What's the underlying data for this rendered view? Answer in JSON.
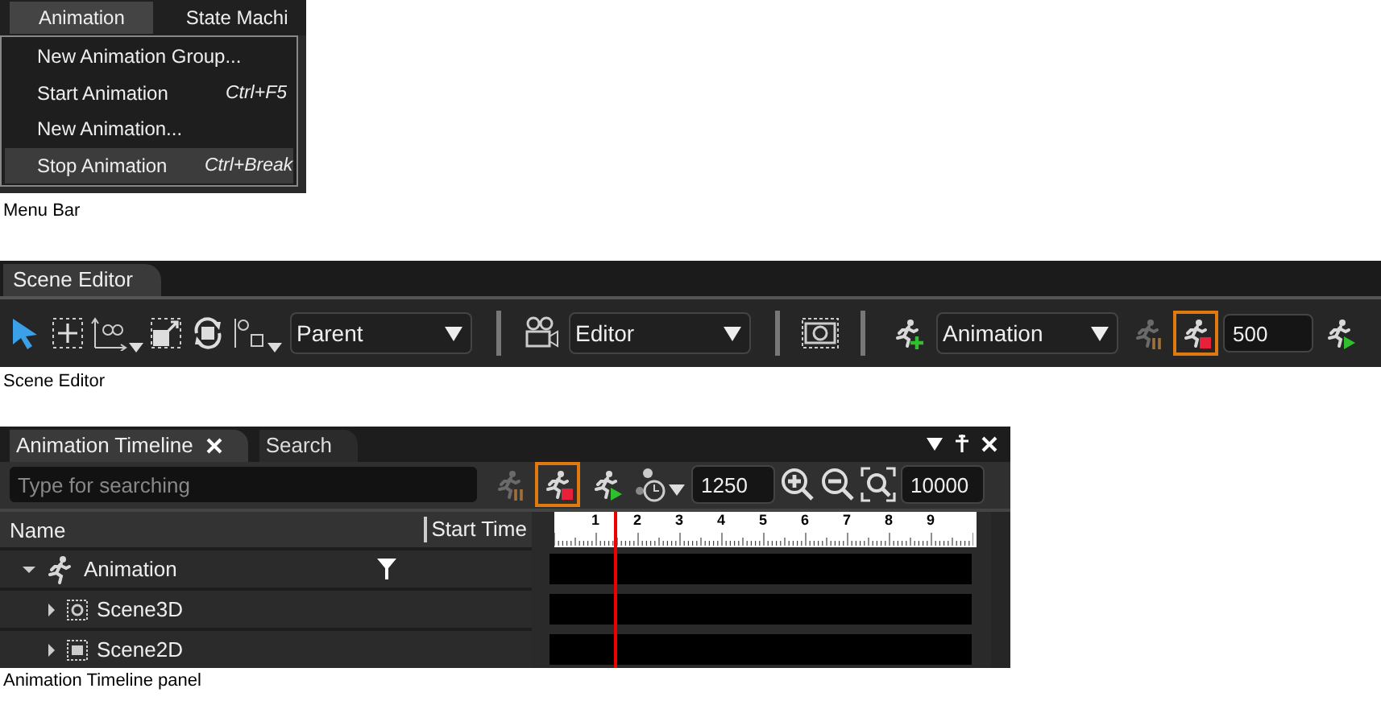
{
  "menu_screenshot": {
    "menus": [
      {
        "label": "Animation",
        "selected": true
      },
      {
        "label": "State Machi",
        "selected": false
      }
    ],
    "menu_items": [
      {
        "label": "New Animation Group...",
        "selected": false
      },
      {
        "label": "Start Animation",
        "shortcut": "Ctrl+F5",
        "selected": false
      },
      {
        "label": "New Animation...",
        "selected": false
      },
      {
        "label": "Stop Animation",
        "shortcut": "Ctrl+Break",
        "selected": true
      }
    ],
    "caption": "Menu Bar"
  },
  "scene_editor_screenshot": {
    "tab": "Scene Editor",
    "coordinate_dropdown": "Parent",
    "camera_dropdown": "Editor",
    "animation_dropdown": "Animation",
    "pause_disabled": true,
    "stop_highlighted": true,
    "duration": "500",
    "caption": "Scene Editor"
  },
  "timeline_screenshot": {
    "tabs": [
      {
        "label": "Animation Timeline",
        "selected": true,
        "closable": true
      },
      {
        "label": "Search",
        "selected": false,
        "closable": false
      }
    ],
    "search": {
      "placeholder": "Type for searching"
    },
    "pause_disabled": true,
    "stop_highlighted": true,
    "current_time": "1250",
    "end_time": "10000",
    "columns": [
      "Name",
      "Start Time"
    ],
    "ruler_labels": [
      "1",
      "2",
      "3",
      "4",
      "5",
      "6",
      "7",
      "8",
      "9"
    ],
    "playhead": {
      "level": 0.125
    },
    "tree": [
      {
        "label": "Animation",
        "kind": "animation",
        "expanded": true,
        "children": [
          {
            "label": "Scene3D",
            "kind": "scene3d",
            "expanded": false
          },
          {
            "label": "Scene2D",
            "kind": "scene2d",
            "expanded": false
          }
        ]
      }
    ],
    "caption": "Animation Timeline panel"
  }
}
